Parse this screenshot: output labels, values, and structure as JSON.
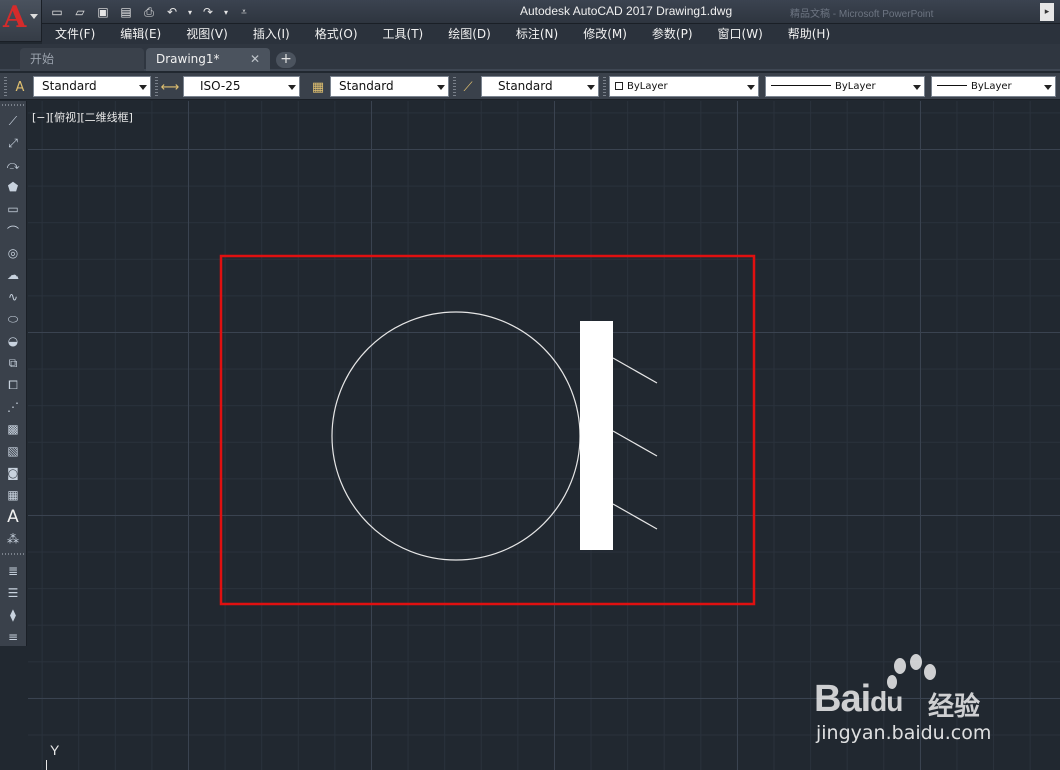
{
  "app": {
    "logo_letter": "A",
    "window_title": "Autodesk AutoCAD 2017    Drawing1.dwg",
    "title_ghost": "精品文稿 - Microsoft PowerPoint",
    "title_scroll": "▸"
  },
  "quick_access": {
    "icons": [
      "new-file-icon",
      "open-folder-icon",
      "save-icon",
      "save-as-icon",
      "print-icon",
      "undo-icon",
      "redo-icon",
      "customize-icon"
    ]
  },
  "menu": {
    "items": [
      "文件(F)",
      "编辑(E)",
      "视图(V)",
      "插入(I)",
      "格式(O)",
      "工具(T)",
      "绘图(D)",
      "标注(N)",
      "修改(M)",
      "参数(P)",
      "窗口(W)",
      "帮助(H)"
    ]
  },
  "tabs": {
    "start": "开始",
    "drawing": "Drawing1*",
    "close": "✕",
    "add": "+"
  },
  "properties": {
    "text_style": "Standard",
    "dim_style": "ISO-25",
    "table_style": "Standard",
    "multileader_style": "Standard",
    "color": "ByLayer",
    "linetype": "ByLayer",
    "lineweight": "ByLayer"
  },
  "viewport": {
    "label": "[−][俯视][二维线框]",
    "ucs_axis": "Y"
  },
  "colors": {
    "canvas": "#212830",
    "highlight": "#e01010",
    "geometry": "#e6e6e6",
    "fill": "#ffffff"
  },
  "watermark": {
    "brand": "Bai",
    "brand_du": "du",
    "product": "经验",
    "url": "jingyan.baidu.com"
  }
}
